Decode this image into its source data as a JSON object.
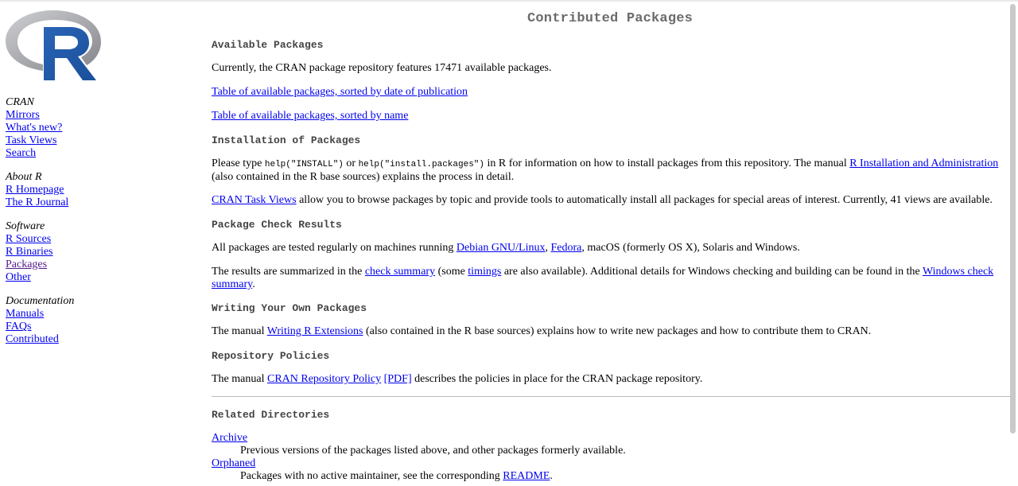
{
  "sidebar": {
    "logo_alt": "R",
    "groups": [
      {
        "category": "CRAN",
        "links": [
          "Mirrors",
          "What's new?",
          "Task Views",
          "Search"
        ]
      },
      {
        "category": "About R",
        "links": [
          "R Homepage",
          "The R Journal"
        ]
      },
      {
        "category": "Software",
        "links": [
          "R Sources",
          "R Binaries",
          "Packages",
          "Other"
        ]
      },
      {
        "category": "Documentation",
        "links": [
          "Manuals",
          "FAQs",
          "Contributed"
        ]
      }
    ]
  },
  "main": {
    "title": "Contributed Packages",
    "available": {
      "heading": "Available Packages",
      "intro_pre": "Currently, the CRAN package repository features 17471 available packages.",
      "link_date": "Table of available packages, sorted by date of publication",
      "link_name": "Table of available packages, sorted by name"
    },
    "installation": {
      "heading": "Installation of Packages",
      "p1_a": "Please type ",
      "code1": "help(\"INSTALL\")",
      "p1_b": " or ",
      "code2": "help(\"install.packages\")",
      "p1_c": " in R for information on how to install packages from this repository. The manual ",
      "link_manual": "R Installation and Administration",
      "p1_d": " (also contained in the R base sources) explains the process in detail.",
      "link_taskviews": "CRAN Task Views",
      "p2": " allow you to browse packages by topic and provide tools to automatically install all packages for special areas of interest. Currently, 41 views are available."
    },
    "check": {
      "heading": "Package Check Results",
      "p1_a": "All packages are tested regularly on machines running ",
      "link_debian": "Debian GNU/Linux",
      "sep": ", ",
      "link_fedora": "Fedora",
      "p1_b": ", macOS (formerly OS X), Solaris and Windows.",
      "p2_a": "The results are summarized in the ",
      "link_check": "check summary",
      "p2_b": " (some ",
      "link_timings": "timings",
      "p2_c": " are also available). Additional details for Windows checking and building can be found in the ",
      "link_windows": "Windows check summary",
      "p2_d": "."
    },
    "writing": {
      "heading": "Writing Your Own Packages",
      "p_a": "The manual ",
      "link": "Writing R Extensions",
      "p_b": " (also contained in the R base sources) explains how to write new packages and how to contribute them to CRAN."
    },
    "policies": {
      "heading": "Repository Policies",
      "p_a": "The manual ",
      "link_policy": "CRAN Repository Policy",
      "link_pdf": "[PDF]",
      "p_b": " describes the policies in place for the CRAN package repository."
    },
    "related": {
      "heading": "Related Directories",
      "items": [
        {
          "link": "Archive",
          "desc": "Previous versions of the packages listed above, and other packages formerly available."
        },
        {
          "link": "Orphaned",
          "desc_a": "Packages with no active maintainer, see the corresponding ",
          "desc_link": "README",
          "desc_b": "."
        }
      ]
    }
  }
}
